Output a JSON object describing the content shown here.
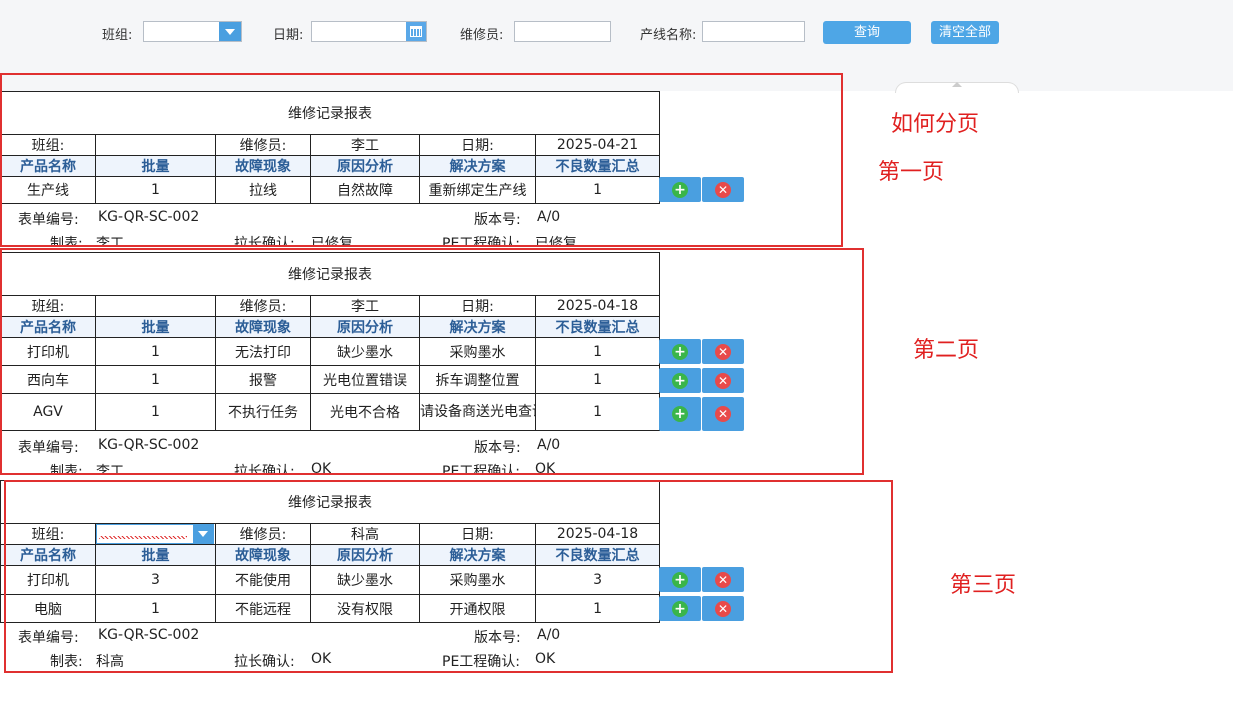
{
  "filter": {
    "team_label": "班组:",
    "date_label": "日期:",
    "repairer_label": "维修员:",
    "line_label": "产线名称:",
    "query_label": "查询",
    "clear_label": "清空全部"
  },
  "annotations": {
    "how": "如何分页",
    "p1": "第一页",
    "p2": "第二页",
    "p3": "第三页"
  },
  "report": {
    "title": "维修记录报表",
    "team_label": "班组:",
    "repairer_label": "维修员:",
    "date_label": "日期:",
    "headers": [
      "产品名称",
      "批量",
      "故障现象",
      "原因分析",
      "解决方案",
      "不良数量汇总"
    ],
    "form_no_label": "表单编号:",
    "form_no": "KG-QR-SC-002",
    "version_label": "版本号:",
    "version": "A/0",
    "maker_label": "制表:",
    "leader_label": "拉长确认:",
    "pe_label": "PE工程确认:"
  },
  "pages": [
    {
      "team": "",
      "repairer": "李工",
      "date": "2025-04-21",
      "rows": [
        [
          "生产线",
          "1",
          "拉线",
          "自然故障",
          "重新绑定生产线",
          "1"
        ]
      ],
      "maker": "李工",
      "leader": "已修复",
      "pe": "已修复"
    },
    {
      "team": "",
      "repairer": "李工",
      "date": "2025-04-18",
      "rows": [
        [
          "打印机",
          "1",
          "无法打印",
          "缺少墨水",
          "采购墨水",
          "1"
        ],
        [
          "西向车",
          "1",
          "报警",
          "光电位置错误",
          "拆车调整位置",
          "1"
        ],
        [
          "AGV",
          "1",
          "不执行任务",
          "光电不合格",
          "请设备商送光电查询安装",
          "1"
        ]
      ],
      "maker": "李工",
      "leader": "OK",
      "pe": "OK"
    },
    {
      "team": "",
      "repairer": "科高",
      "date": "2025-04-18",
      "rows": [
        [
          "打印机",
          "3",
          "不能使用",
          "缺少墨水",
          "采购墨水",
          "3"
        ],
        [
          "电脑",
          "1",
          "不能远程",
          "没有权限",
          "开通权限",
          "1"
        ]
      ],
      "maker": "科高",
      "leader": "OK",
      "pe": "OK"
    }
  ]
}
